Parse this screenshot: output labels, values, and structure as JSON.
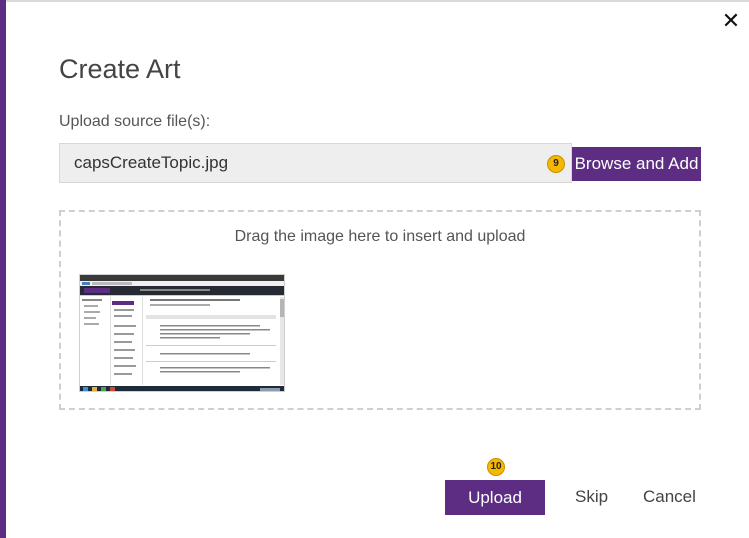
{
  "dialog": {
    "title": "Create Art",
    "close_glyph": "✕",
    "upload_label": "Upload source file(s):",
    "file_input_value": "capsCreateTopic.jpg",
    "browse_button_label": "Browse and Add",
    "drop_hint": "Drag the image here to insert and upload",
    "upload_button_label": "Upload",
    "skip_label": "Skip",
    "cancel_label": "Cancel"
  },
  "callouts": {
    "browse": "9",
    "upload": "10"
  },
  "thumbnail": {
    "description_icon": "screenshot-thumbnail-icon"
  },
  "colors": {
    "accent": "#5c2d82",
    "badge": "#f5b800"
  }
}
